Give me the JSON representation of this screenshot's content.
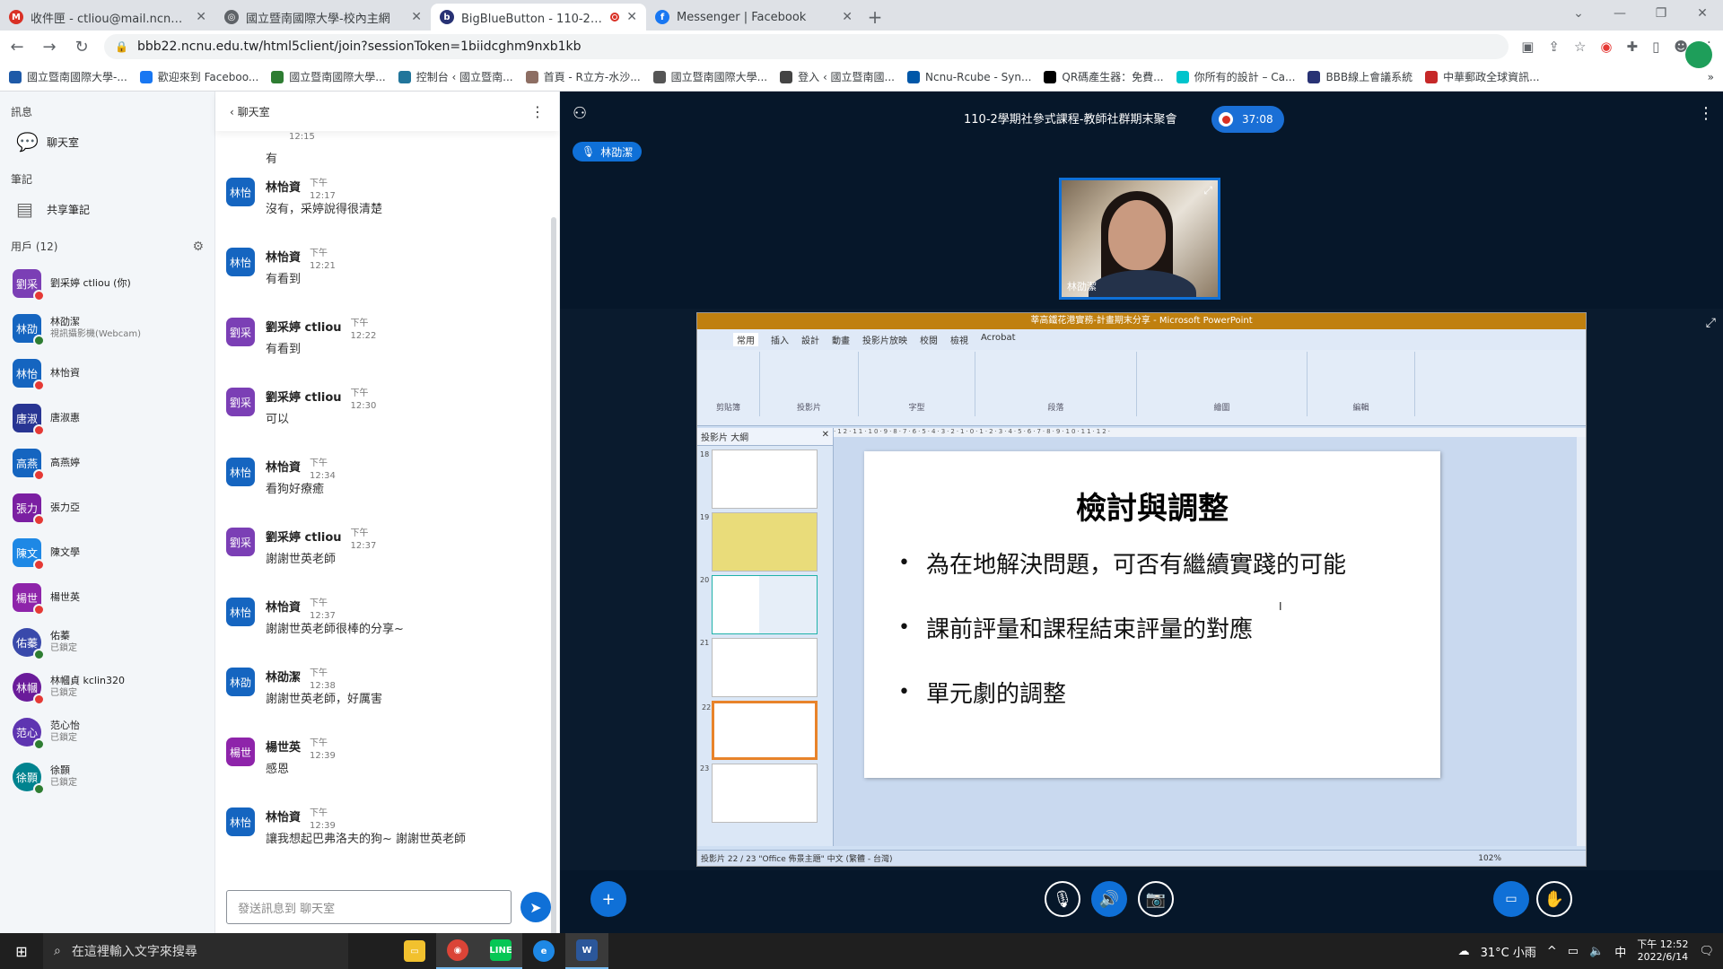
{
  "browser": {
    "tabs": [
      {
        "label": "收件匣 - ctliou@mail.ncnu.edu...",
        "icon": "gmail-icon",
        "color": "#d93025",
        "glyph": "M"
      },
      {
        "label": "國立暨南國際大學-校內主網",
        "icon": "globe-icon",
        "color": "#5f6368",
        "glyph": "◎"
      },
      {
        "label": "BigBlueButton - 110-2學期",
        "icon": "bbb-icon",
        "color": "#283274",
        "glyph": "b"
      },
      {
        "label": "Messenger | Facebook",
        "icon": "facebook-icon",
        "color": "#1877f2",
        "glyph": "f"
      }
    ],
    "url": "bbb22.ncnu.edu.tw/html5client/join?sessionToken=1biidcghm9nxb1kb",
    "bookmarks": [
      {
        "label": "國立暨南國際大學-...",
        "color": "#1e5aa8"
      },
      {
        "label": "歡迎來到 Faceboo...",
        "color": "#1877f2"
      },
      {
        "label": "國立暨南國際大學...",
        "color": "#2e7d32"
      },
      {
        "label": "控制台 ‹ 國立暨南...",
        "color": "#21759b"
      },
      {
        "label": "首頁 - R立方-水沙...",
        "color": "#8d6e63"
      },
      {
        "label": "國立暨南國際大學...",
        "color": "#555"
      },
      {
        "label": "登入 ‹ 國立暨南國...",
        "color": "#444"
      },
      {
        "label": "Ncnu-Rcube - Syn...",
        "color": "#0057a8"
      },
      {
        "label": "QR碼產生器：免費...",
        "color": "#000"
      },
      {
        "label": "你所有的設計 – Ca...",
        "color": "#00c4cc"
      },
      {
        "label": "BBB線上會議系統",
        "color": "#283274"
      },
      {
        "label": "中華郵政全球資訊...",
        "color": "#c62828"
      }
    ]
  },
  "sidebar": {
    "messages_title": "訊息",
    "chat_label": "聊天室",
    "notes_title": "筆記",
    "shared_notes_label": "共享筆記",
    "users_title": "用戶 (12)",
    "users": [
      {
        "avatar": "劉采",
        "name": "劉采婷 ctliou (你)",
        "sub": "",
        "color": "#7b3fb5",
        "status": "#e53935",
        "round": false
      },
      {
        "avatar": "林劭",
        "name": "林劭潔",
        "sub": "視訊攝影機(Webcam)",
        "color": "#1565c0",
        "status": "#2e7d32",
        "round": false
      },
      {
        "avatar": "林怡",
        "name": "林怡資",
        "sub": "",
        "color": "#1565c0",
        "status": "#e53935",
        "round": false
      },
      {
        "avatar": "唐淑",
        "name": "唐淑惠",
        "sub": "",
        "color": "#283593",
        "status": "#e53935",
        "round": false
      },
      {
        "avatar": "高燕",
        "name": "高燕婷",
        "sub": "",
        "color": "#1565c0",
        "status": "#e53935",
        "round": false
      },
      {
        "avatar": "張力",
        "name": "張力亞",
        "sub": "",
        "color": "#7b1fa2",
        "status": "#e53935",
        "round": false
      },
      {
        "avatar": "陳文",
        "name": "陳文學",
        "sub": "",
        "color": "#1e88e5",
        "status": "#e53935",
        "round": false
      },
      {
        "avatar": "楊世",
        "name": "楊世英",
        "sub": "",
        "color": "#8e24aa",
        "status": "#e53935",
        "round": false
      },
      {
        "avatar": "佑蓁",
        "name": "佑蓁",
        "sub": "已鎖定",
        "color": "#3949ab",
        "status": "#2e7d32",
        "round": true
      },
      {
        "avatar": "林幗",
        "name": "林幗貞 kclin320",
        "sub": "已鎖定",
        "color": "#6a1b9a",
        "status": "#e53935",
        "round": true
      },
      {
        "avatar": "范心",
        "name": "范心怡",
        "sub": "已鎖定",
        "color": "#5e35b1",
        "status": "#2e7d32",
        "round": true
      },
      {
        "avatar": "徐顥",
        "name": "徐顥",
        "sub": "已鎖定",
        "color": "#00838f",
        "status": "#2e7d32",
        "round": true
      }
    ]
  },
  "chat": {
    "header": "聊天室",
    "partial": {
      "time": "12:15",
      "text": "有"
    },
    "messages": [
      {
        "avatar": "林怡",
        "name": "林怡資",
        "ampm": "下午",
        "time": "12:17",
        "text": "沒有，采婷說得很清楚",
        "color": "#1565c0"
      },
      {
        "avatar": "林怡",
        "name": "林怡資",
        "ampm": "下午",
        "time": "12:21",
        "text": "有看到",
        "color": "#1565c0"
      },
      {
        "avatar": "劉采",
        "name": "劉采婷 ctliou",
        "ampm": "下午",
        "time": "12:22",
        "text": "有看到",
        "color": "#7b3fb5"
      },
      {
        "avatar": "劉采",
        "name": "劉采婷 ctliou",
        "ampm": "下午",
        "time": "12:30",
        "text": "可以",
        "color": "#7b3fb5"
      },
      {
        "avatar": "林怡",
        "name": "林怡資",
        "ampm": "下午",
        "time": "12:34",
        "text": "看狗好療癒",
        "color": "#1565c0"
      },
      {
        "avatar": "劉采",
        "name": "劉采婷 ctliou",
        "ampm": "下午",
        "time": "12:37",
        "text": "謝謝世英老師",
        "color": "#7b3fb5"
      },
      {
        "avatar": "林怡",
        "name": "林怡資",
        "ampm": "下午",
        "time": "12:37",
        "text": "謝謝世英老師很棒的分享~",
        "color": "#1565c0"
      },
      {
        "avatar": "林劭",
        "name": "林劭潔",
        "ampm": "下午",
        "time": "12:38",
        "text": "謝謝世英老師，好厲害",
        "color": "#1565c0"
      },
      {
        "avatar": "楊世",
        "name": "楊世英",
        "ampm": "下午",
        "time": "12:39",
        "text": "感恩",
        "color": "#8e24aa"
      },
      {
        "avatar": "林怡",
        "name": "林怡資",
        "ampm": "下午",
        "time": "12:39",
        "text": "讓我想起巴弗洛夫的狗~ 謝謝世英老師",
        "color": "#1565c0"
      }
    ],
    "input_placeholder": "發送訊息到 聊天室"
  },
  "meeting": {
    "title": "110-2學期社參式課程-教師社群期末聚會",
    "rec_time": "37:08",
    "talker": "林劭潔",
    "webcam_name": "林劭潔"
  },
  "presentation": {
    "window_title": "莘高鐵花港實務-計畫期末分享 - Microsoft PowerPoint",
    "ribbon_tabs": [
      "常用",
      "插入",
      "設計",
      "動畫",
      "投影片放映",
      "校閱",
      "檢視",
      "Acrobat"
    ],
    "ribbon_groups": [
      "剪貼簿",
      "投影片",
      "字型",
      "段落",
      "繪圖",
      "編輯"
    ],
    "panel_tabs": "投影片  大綱",
    "thumb_numbers": [
      "18",
      "19",
      "20",
      "21",
      "22",
      "23"
    ],
    "slide_title": "檢討與調整",
    "bullets": [
      "為在地解決問題，可否有繼續實踐的可能",
      "課前評量和課程結束評量的對應",
      "單元劇的調整"
    ],
    "status": "投影片 22 / 23   \"Office 佈景主題\"   中文 (繁體 - 台灣)",
    "zoom": "102%"
  },
  "taskbar": {
    "search_placeholder": "在這裡輸入文字來搜尋",
    "weather": "31°C 小雨",
    "ime": "中",
    "time": "下午 12:52",
    "date": "2022/6/14"
  }
}
